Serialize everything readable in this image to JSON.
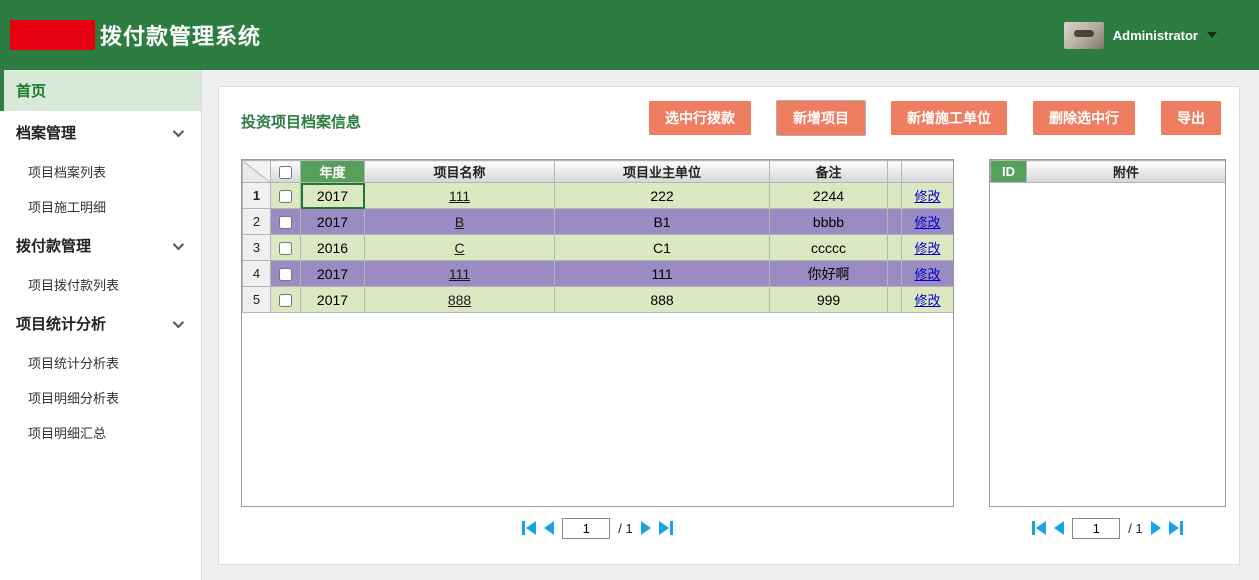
{
  "colors": {
    "header_green": "#2d7d43",
    "accent_green": "#1d7a2f",
    "sorted_header_green": "#56a05c",
    "button_salmon": "#ee7d62",
    "row_green": "#dce8c2",
    "row_purple": "#9a8cc2",
    "edit_link_blue": "#0000cc",
    "pagination_blue": "#18a3e8",
    "logo_red": "#e60012"
  },
  "header": {
    "title": "拨付款管理系统",
    "user": {
      "name": "Administrator"
    }
  },
  "sidebar": {
    "items": [
      {
        "label": "首页"
      },
      {
        "label": "档案管理"
      },
      {
        "label": "项目档案列表"
      },
      {
        "label": "项目施工明细"
      },
      {
        "label": "拨付款管理"
      },
      {
        "label": "项目拨付款列表"
      },
      {
        "label": "项目统计分析"
      },
      {
        "label": "项目统计分析表"
      },
      {
        "label": "项目明细分析表"
      },
      {
        "label": "项目明细汇总"
      }
    ]
  },
  "main": {
    "section_title": "投资项目档案信息",
    "buttons": [
      {
        "label": "选中行拨款"
      },
      {
        "label": "新增项目"
      },
      {
        "label": "新增施工单位"
      },
      {
        "label": "删除选中行"
      },
      {
        "label": "导出"
      }
    ],
    "table": {
      "headers": {
        "year": "年度",
        "name": "项目名称",
        "owner": "项目业主单位",
        "remark": "备注"
      },
      "edit_label": "修改",
      "focused_cell": {
        "row": 0,
        "col": "year"
      },
      "rows": [
        {
          "num": "1",
          "year": "2017",
          "name": "111",
          "owner": "222",
          "remark": "2244",
          "checked": false,
          "highlighted": false,
          "current": true
        },
        {
          "num": "2",
          "year": "2017",
          "name": "B",
          "owner": "B1",
          "remark": "bbbb",
          "checked": false,
          "highlighted": true,
          "current": false
        },
        {
          "num": "3",
          "year": "2016",
          "name": "C",
          "owner": "C1",
          "remark": "ccccc",
          "checked": false,
          "highlighted": false,
          "current": false
        },
        {
          "num": "4",
          "year": "2017",
          "name": "111",
          "owner": "111",
          "remark": "你好啊",
          "checked": false,
          "highlighted": true,
          "current": false
        },
        {
          "num": "5",
          "year": "2017",
          "name": "888",
          "owner": "888",
          "remark": "999",
          "checked": false,
          "highlighted": false,
          "current": false
        }
      ],
      "pagination": {
        "page": "1",
        "total": "/ 1"
      }
    },
    "attachments": {
      "headers": {
        "id": "ID",
        "file": "附件"
      },
      "rows": [],
      "pagination": {
        "page": "1",
        "total": "/ 1"
      }
    }
  }
}
